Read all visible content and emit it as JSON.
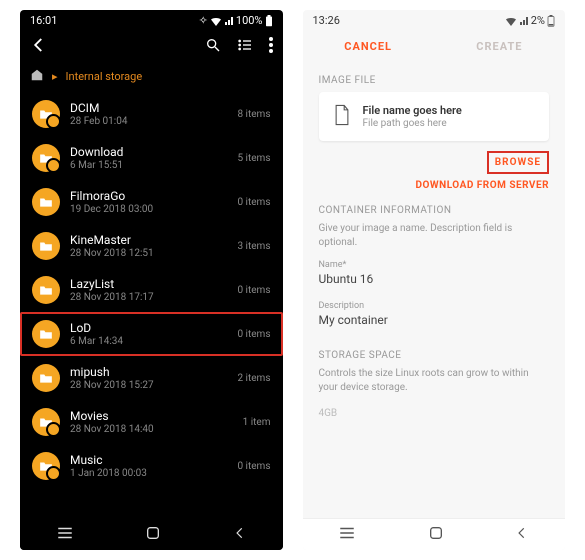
{
  "left": {
    "status": {
      "time": "16:01",
      "battery": "100%",
      "wifi_icon": "wifi-icon",
      "signal_icon": "signal-icon",
      "batt_icon": "battery-full-icon",
      "vibrate_icon": "vibrate-icon"
    },
    "breadcrumb": {
      "home_icon": "home-icon",
      "sep_icon": "chevron-right-icon",
      "label": "Internal storage"
    },
    "topbar": {
      "back_icon": "chevron-left-icon",
      "search_icon": "search-icon",
      "list_icon": "list-icon",
      "more_icon": "more-vert-icon"
    },
    "items": [
      {
        "name": "DCIM",
        "date": "28 Feb 01:04",
        "count": "8 items",
        "badge": true
      },
      {
        "name": "Download",
        "date": "6 Mar 15:51",
        "count": "5 items",
        "badge": true
      },
      {
        "name": "FilmoraGo",
        "date": "19 Dec 2018 03:00",
        "count": "0 items",
        "badge": false
      },
      {
        "name": "KineMaster",
        "date": "28 Nov 2018 12:51",
        "count": "3 items",
        "badge": false
      },
      {
        "name": "LazyList",
        "date": "28 Nov 2018 17:17",
        "count": "0 items",
        "badge": false
      },
      {
        "name": "LoD",
        "date": "6 Mar 14:34",
        "count": "0 items",
        "badge": false,
        "selected": true
      },
      {
        "name": "mipush",
        "date": "28 Nov 2018 15:27",
        "count": "2 items",
        "badge": false
      },
      {
        "name": "Movies",
        "date": "28 Nov 2018 14:40",
        "count": "1 item",
        "badge": true
      },
      {
        "name": "Music",
        "date": "1 Jan 2018 00:03",
        "count": "0 items",
        "badge": true
      }
    ]
  },
  "right": {
    "status": {
      "time": "13:26",
      "battery": "2%",
      "wifi_icon": "wifi-icon",
      "signal_icon": "signal-icon",
      "batt_icon": "battery-low-icon"
    },
    "tabs": {
      "cancel": "CANCEL",
      "create": "CREATE",
      "cancel_color": "#ff5722",
      "create_color": "#c9c1be"
    },
    "image_file": {
      "label": "IMAGE FILE",
      "title": "File name goes here",
      "path": "File path goes here",
      "file_icon": "file-icon",
      "browse": "BROWSE",
      "download": "DOWNLOAD FROM SERVER"
    },
    "container": {
      "label": "CONTAINER INFORMATION",
      "desc": "Give your image a name. Description field is optional.",
      "name_label": "Name*",
      "name_value": "Ubuntu 16",
      "desc_label": "Description",
      "desc_value": "My container"
    },
    "storage": {
      "label": "STORAGE SPACE",
      "desc": "Controls the size Linux roots can grow to within your device storage.",
      "value": "4GB"
    }
  },
  "nav": {
    "recents_icon": "recents-icon",
    "home_icon": "home-nav-icon",
    "back_icon": "back-nav-icon"
  }
}
